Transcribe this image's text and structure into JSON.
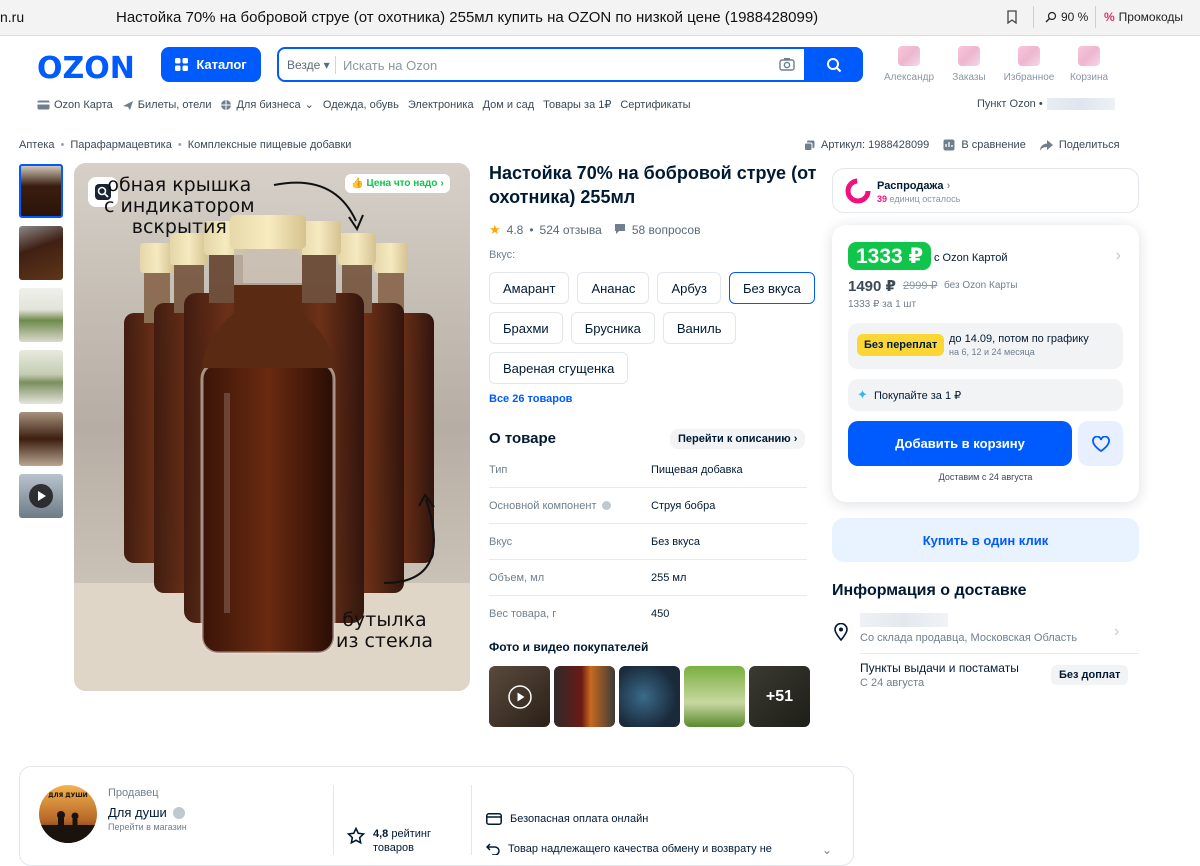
{
  "browser": {
    "url_fragment": "n.ru",
    "title": "Настойка 70% на бобровой струе (от охотника) 255мл купить на OZON по низкой цене (1988428099)",
    "zoom": "90 %",
    "promo": "Промокоды"
  },
  "header": {
    "logo": "OZON",
    "catalog_label": "Каталог",
    "search_scope": "Везде",
    "search_placeholder": "Искать на Ozon",
    "icons": [
      {
        "icon": "user-icon",
        "label": "Александр"
      },
      {
        "icon": "box-icon",
        "label": "Заказы"
      },
      {
        "icon": "heart-icon",
        "label": "Избранное"
      },
      {
        "icon": "cart-icon",
        "label": "Корзина"
      }
    ]
  },
  "nav": {
    "items": [
      "Ozon Карта",
      "Билеты, отели",
      "Для бизнеса",
      "Одежда, обувь",
      "Электроника",
      "Дом и сад",
      "Товары за 1₽",
      "Сертификаты"
    ],
    "pickup": "Пункт Ozon •"
  },
  "breadcrumbs": [
    "Аптека",
    "Парафармацевтика",
    "Комплексные пищевые добавки"
  ],
  "meta": {
    "article": "Артикул: 1988428099",
    "compare": "В сравнение",
    "share": "Поделиться"
  },
  "gallery": {
    "overlay_top": "обная крышка\nс индикатором\nвскрытия",
    "overlay_bottom": "бутылка\nиз стекла",
    "badge": "Цена что надо"
  },
  "product": {
    "title": "Настойка 70% на бобровой струе (от охотника) 255мл",
    "rating": "4.8",
    "reviews": "524 отзыва",
    "questions": "58 вопросов",
    "taste_label": "Вкус:",
    "tastes": [
      "Амарант",
      "Ананас",
      "Арбуз",
      "Без вкуса",
      "Брахми",
      "Брусника",
      "Ваниль",
      "Вареная сгущенка"
    ],
    "selected_taste": "Без вкуса",
    "all_goods": "Все 26 товаров",
    "about_title": "О товаре",
    "to_description": "Перейти к описанию",
    "props": [
      {
        "k": "Тип",
        "v": "Пищевая добавка"
      },
      {
        "k": "Основной компонент",
        "v": "Струя бобра"
      },
      {
        "k": "Вкус",
        "v": "Без вкуса"
      },
      {
        "k": "Объем, мл",
        "v": "255 мл"
      },
      {
        "k": "Вес товара, г",
        "v": "450"
      }
    ],
    "photos_title": "Фото и видео покупателей",
    "photos_more": "+51"
  },
  "sale": {
    "title": "Распродажа",
    "count": "39",
    "rest": "единиц осталось"
  },
  "price": {
    "card_price": "1333 ₽",
    "with_card": "с Ozon Картой",
    "price": "1490 ₽",
    "old_price": "2999 ₽",
    "no_card": "без Ozon Карты",
    "per_unit": "1333 ₽ за 1 шт",
    "installment_tag": "Без переплат",
    "installment_a": "до 14.09, потом по графику",
    "installment_b": "на 6, 12 и 24 месяца",
    "buy_for_one": "Покупайте за 1 ₽",
    "add_to_cart": "Добавить в корзину",
    "delivery": "Доставим с 24 августа",
    "one_click": "Купить в один клик"
  },
  "delivery_info": {
    "title": "Информация о доставке",
    "store": "Со склада продавца, Московская Область",
    "pickup_points": "Пункты выдачи и постаматы",
    "pickup_date": "С 24 августа",
    "no_extra": "Без доплат"
  },
  "seller": {
    "label": "Продавец",
    "name": "Для души",
    "go": "Перейти в магазин",
    "avatar_text": "ДЛЯ ДУШИ",
    "rating": "4,8",
    "rating_text": "рейтинг",
    "rating_text2": "товаров",
    "guarantee1": "Безопасная оплата онлайн",
    "guarantee2": "Товар надлежащего качества обменy и возврату не"
  },
  "colors": {
    "brand": "#005bff",
    "green": "#10c44c",
    "pink": "#f1117e",
    "yellow": "#fcd635"
  }
}
